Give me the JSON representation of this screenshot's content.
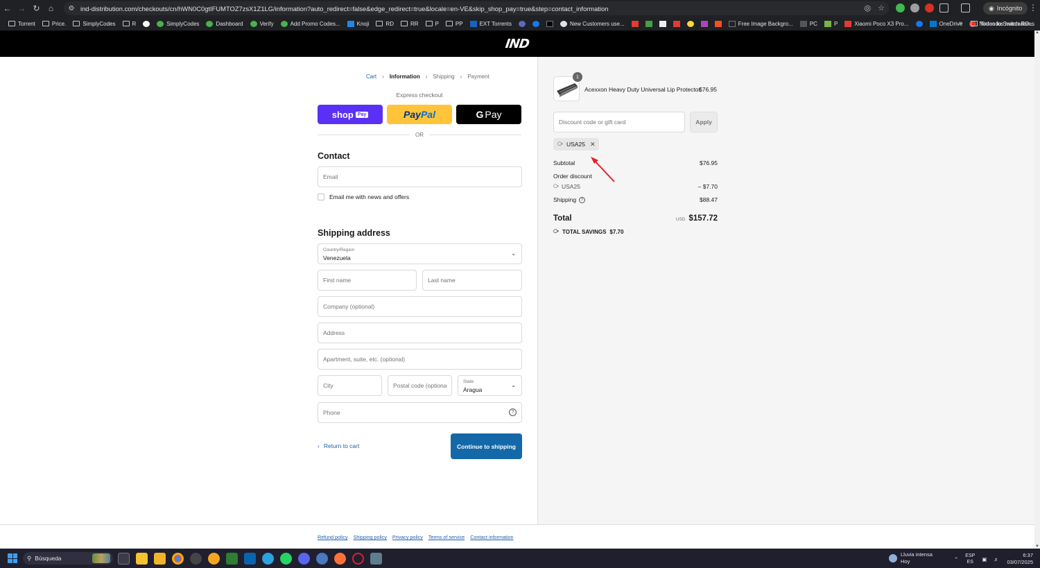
{
  "browser": {
    "url": "ind-distribution.com/checkouts/cn/hWN0C0gtIFUMTOZ7zsX1Z1LG/information?auto_redirect=false&edge_redirect=true&locale=en-VE&skip_shop_pay=true&step=contact_information",
    "profile_label": "Incógnito",
    "bookmarks": [
      "Torrent",
      "Price.",
      "SimplyCodes",
      "R",
      "SimplyCodes",
      "Dashboard",
      "Verify",
      "Add Promo Codes...",
      "Knoji",
      "RD",
      "RR",
      "P",
      "PP",
      "EXT Torrents",
      "New Customers use...",
      "Free Image Backgro...",
      "PC",
      "P",
      "Xiaomi Poco X3 Pro...",
      "OneDrive",
      "Nintendo Switch RO..."
    ],
    "bookmarks_right": "Todos los marcadores"
  },
  "store": {
    "logo": "IND"
  },
  "breadcrumb": {
    "cart": "Cart",
    "information": "Information",
    "shipping": "Shipping",
    "payment": "Payment"
  },
  "express": {
    "label": "Express checkout",
    "shop_label": "shop",
    "shop_chip": "Pay",
    "paypal_pay": "Pay",
    "paypal_pal": "Pal",
    "gpay_g": "G",
    "gpay_pay": "Pay",
    "or": "OR"
  },
  "contact": {
    "title": "Contact",
    "email_placeholder": "Email",
    "newsletter_label": "Email me with news and offers"
  },
  "shipping": {
    "title": "Shipping address",
    "country_label": "Country/Region",
    "country_value": "Venezuela",
    "first_name_placeholder": "First name",
    "last_name_placeholder": "Last name",
    "company_placeholder": "Company (optional)",
    "address_placeholder": "Address",
    "apartment_placeholder": "Apartment, suite, etc. (optional)",
    "city_placeholder": "City",
    "postal_placeholder": "Postal code (optional)",
    "state_label": "State",
    "state_value": "Aragua",
    "phone_placeholder": "Phone"
  },
  "actions": {
    "return_label": "Return to cart",
    "continue_label": "Continue to shipping"
  },
  "summary": {
    "item_quantity": "1",
    "product_name": "Acexxon Heavy Duty Universal Lip Protector",
    "product_price": "$76.95",
    "discount_placeholder": "Discount code or gift card",
    "apply_label": "Apply",
    "applied_code": "USA25",
    "subtotal_label": "Subtotal",
    "subtotal_value": "$76.95",
    "order_discount_label": "Order discount",
    "discount_code": "USA25",
    "discount_value": "– $7.70",
    "shipping_label": "Shipping",
    "shipping_value": "$88.47",
    "total_label": "Total",
    "currency": "USD",
    "total_value": "$157.72",
    "savings_label": "TOTAL SAVINGS",
    "savings_value": "$7.70"
  },
  "footer": {
    "links": [
      "Refund policy",
      "Shipping policy",
      "Privacy policy",
      "Terms of service",
      "Contact information"
    ]
  },
  "taskbar": {
    "search_label": "Búsqueda",
    "weather_line1": "Lluvia intensa",
    "weather_line2": "Hoy",
    "lang_line1": "ESP",
    "lang_line2": "ES",
    "time": "6:37",
    "date": "03/07/2025"
  },
  "colors": {
    "shop_pay": "#5a31f4",
    "paypal": "#ffc439",
    "primary_button": "#1468a8",
    "link": "#1f5ea8",
    "annotation_arrow": "#e8202a"
  }
}
